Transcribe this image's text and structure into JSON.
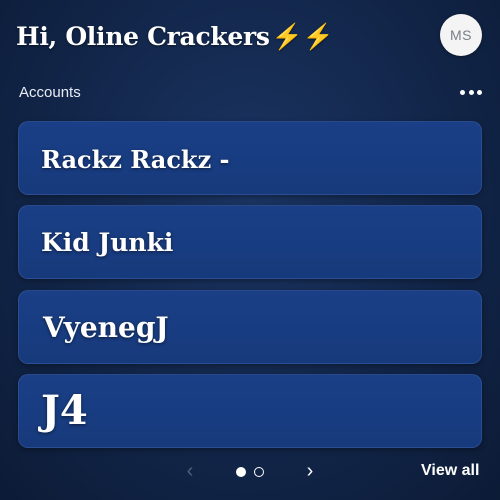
{
  "header": {
    "greeting": "Hi, Oline Crackers",
    "greeting_emoji": "⚡⚡",
    "avatar_initials": "MS"
  },
  "accounts": {
    "label": "Accounts",
    "items": [
      {
        "name": "Rackz Rackz -"
      },
      {
        "name": "Kid Junki"
      },
      {
        "name": "VyenegJ"
      },
      {
        "name": "J4"
      }
    ]
  },
  "pager": {
    "prev_icon": "‹",
    "next_icon": "›",
    "page_count": 2,
    "active_page": 1,
    "view_all_label": "View all"
  },
  "icons": {
    "more": "more-horizontal-icon",
    "prev": "chevron-left-icon",
    "next": "chevron-right-icon",
    "bolt": "lightning-bolt-icon"
  },
  "colors": {
    "background": "#12264a",
    "card": "#1a3f86",
    "bolt": "#f6c21a",
    "avatar_bg": "#f4f4f4",
    "avatar_text": "#7a7f88"
  }
}
